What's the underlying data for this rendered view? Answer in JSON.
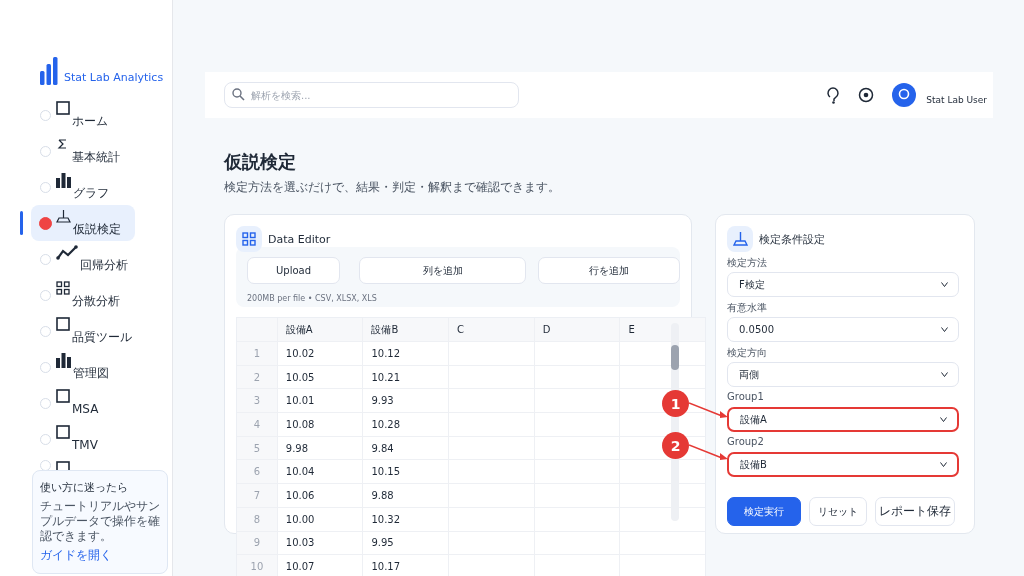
{
  "sidebar": {
    "logo": "Stat Lab Analytics",
    "items": [
      {
        "label": "ホーム",
        "kind": "square",
        "selected": false
      },
      {
        "label": "基本統計",
        "kind": "sigma",
        "selected": false
      },
      {
        "label": "グラフ",
        "kind": "bars",
        "selected": false
      },
      {
        "label": "仮説検定",
        "kind": "flask",
        "selected": true
      },
      {
        "label": "回帰分析",
        "kind": "line",
        "selected": false
      },
      {
        "label": "分散分析",
        "kind": "grid",
        "selected": false
      },
      {
        "label": "品質ツール",
        "kind": "square",
        "selected": false
      },
      {
        "label": "管理図",
        "kind": "bars",
        "selected": false
      },
      {
        "label": "MSA",
        "kind": "square",
        "selected": false
      },
      {
        "label": "TMV",
        "kind": "square",
        "selected": false
      },
      {
        "kind": "square",
        "selected": false
      }
    ],
    "help": {
      "title": "使い方に迷ったら",
      "text": "チュートリアルやサンプルデータで操作を確認できます。",
      "link": "ガイドを開く"
    }
  },
  "topbar": {
    "search": {
      "placeholder": "解析を検索..."
    },
    "user": "Stat Lab User"
  },
  "page": {
    "title": "仮説検定",
    "subtitle": "検定方法を選ぶだけで、結果・判定・解釈まで確認できます。"
  },
  "data_editor": {
    "title": "Data Editor",
    "buttons": [
      "Upload",
      "列を追加",
      "行を追加"
    ],
    "hint": "200MB per file • CSV, XLSX, XLS",
    "table": {
      "columns": [
        "",
        "設備A",
        "設備B",
        "C",
        "D",
        "E"
      ],
      "rows": [
        [
          "1",
          "10.02",
          "10.12"
        ],
        [
          "2",
          "10.05",
          "10.21"
        ],
        [
          "3",
          "10.01",
          "9.93"
        ],
        [
          "4",
          "10.08",
          "10.28"
        ],
        [
          "5",
          "9.98",
          "9.84"
        ],
        [
          "6",
          "10.04",
          "10.15"
        ],
        [
          "7",
          "10.06",
          "9.88"
        ],
        [
          "8",
          "10.00",
          "10.32"
        ],
        [
          "9",
          "10.03",
          "9.95"
        ],
        [
          "10",
          "10.07",
          "10.17"
        ]
      ]
    }
  },
  "settings": {
    "title": "検定条件設定",
    "fields": [
      {
        "label": "検定方法",
        "value": "F検定",
        "highlighted": false
      },
      {
        "label": "有意水準",
        "value": "0.0500",
        "highlighted": false
      },
      {
        "label": "検定方向",
        "value": "両側",
        "highlighted": false
      },
      {
        "label": "Group1",
        "value": "設備A",
        "highlighted": true
      },
      {
        "label": "Group2",
        "value": "設備B",
        "highlighted": true
      }
    ],
    "buttons": [
      {
        "label": "検定実行",
        "kind": "primary"
      },
      {
        "label": "リセット",
        "kind": "secondary"
      },
      {
        "label": "レポート保存",
        "kind": "secondary"
      }
    ]
  },
  "annotations": [
    {
      "number": "1"
    },
    {
      "number": "2"
    }
  ]
}
